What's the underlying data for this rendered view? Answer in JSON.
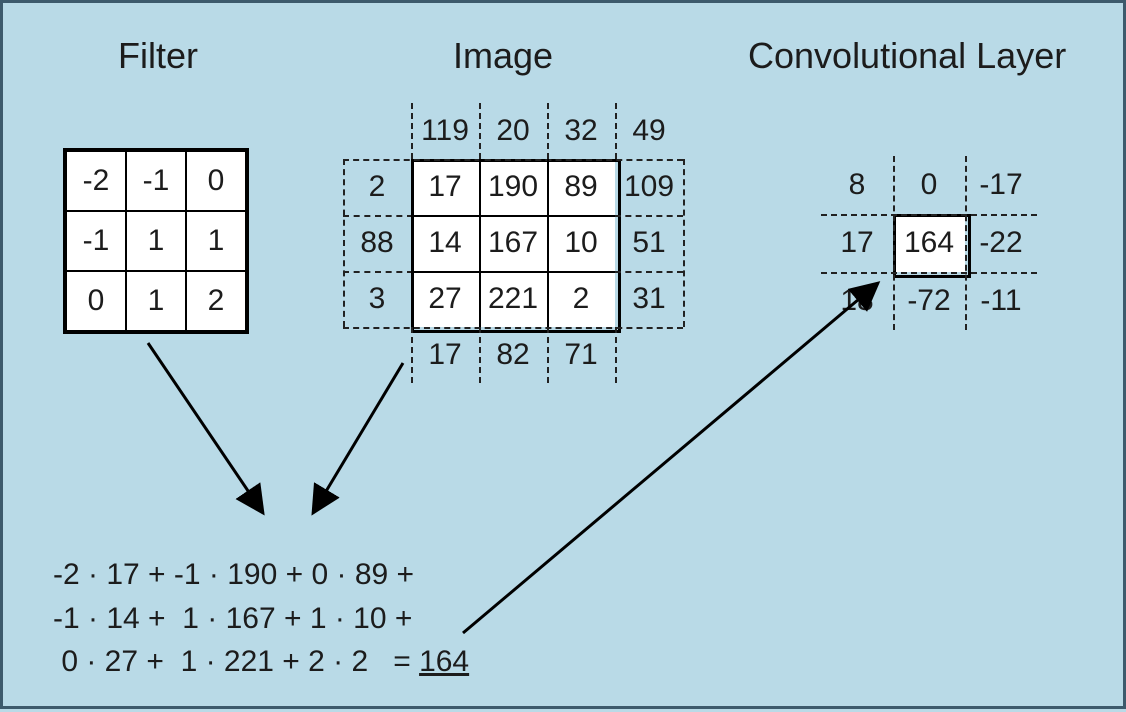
{
  "titles": {
    "filter": "Filter",
    "image": "Image",
    "conv": "Convolutional Layer"
  },
  "filter": [
    [
      "-2",
      "-1",
      "0"
    ],
    [
      "-1",
      "1",
      "1"
    ],
    [
      "0",
      "1",
      "2"
    ]
  ],
  "image": [
    [
      "",
      "119",
      "20",
      "32",
      "49"
    ],
    [
      "2",
      "17",
      "190",
      "89",
      "109"
    ],
    [
      "88",
      "14",
      "167",
      "10",
      "51"
    ],
    [
      "3",
      "27",
      "221",
      "2",
      "31"
    ],
    [
      "",
      "17",
      "82",
      "71",
      ""
    ]
  ],
  "conv": [
    [
      "8",
      "0",
      "-17"
    ],
    [
      "17",
      "164",
      "-22"
    ],
    [
      "18",
      "-72",
      "-11"
    ]
  ],
  "equation": {
    "line1": "-2 · 17 + -1 · 190 + 0 · 89 +",
    "line2": "-1 · 14 +  1 · 167 + 1 · 10 +",
    "line3_left": " 0 · 27 +  1 · 221 + 2 · 2   = ",
    "result": "164"
  }
}
